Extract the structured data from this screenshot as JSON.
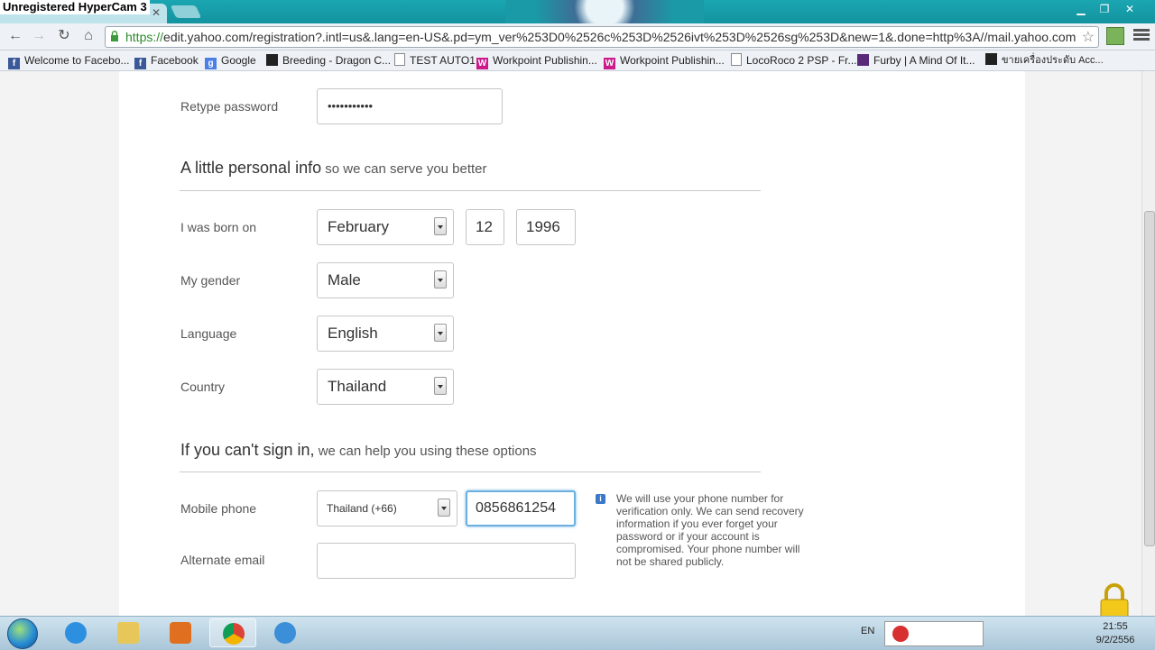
{
  "watermark": "Unregistered HyperCam 3",
  "browser": {
    "tab_close": "✕",
    "window_controls": [
      "▁",
      "❐",
      "✕"
    ],
    "url_scheme": "https://",
    "url_rest": "edit.yahoo.com/registration?.intl=us&.lang=en-US&.pd=ym_ver%253D0%2526c%253D%2526ivt%253D%2526sg%253D&new=1&.done=http%3A//mail.yahoo.com",
    "nav_icons": [
      "back-icon",
      "forward-icon",
      "reload-icon",
      "home-icon"
    ]
  },
  "bookmarks": [
    {
      "label": "Welcome to Facebo...",
      "icon": "facebook-icon"
    },
    {
      "label": "Facebook",
      "icon": "facebook-icon"
    },
    {
      "label": "Google",
      "icon": "google-icon"
    },
    {
      "label": "Breeding - Dragon C...",
      "icon": "dragon-icon"
    },
    {
      "label": "TEST AUTO1",
      "icon": "page-icon"
    },
    {
      "label": "Workpoint Publishin...",
      "icon": "workpoint-icon"
    },
    {
      "label": "Workpoint Publishin...",
      "icon": "workpoint-icon"
    },
    {
      "label": "LocoRoco 2 PSP - Fr...",
      "icon": "page-icon"
    },
    {
      "label": "Furby | A Mind Of It...",
      "icon": "furby-icon"
    },
    {
      "label": "ขายเครื่องประดับ Acc...",
      "icon": "dark-icon"
    }
  ],
  "form": {
    "retype_password": {
      "label": "Retype password",
      "value": "•••••••••••"
    },
    "personal_section": {
      "title": "A little personal info",
      "subtitle": " so we can serve you better"
    },
    "birth": {
      "label": "I was born on",
      "month": "February",
      "day": "12",
      "year": "1996"
    },
    "gender": {
      "label": "My gender",
      "value": "Male"
    },
    "language": {
      "label": "Language",
      "value": "English"
    },
    "country": {
      "label": "Country",
      "value": "Thailand"
    },
    "recovery_section": {
      "title": "If you can't sign in,",
      "subtitle": " we can help you using these options"
    },
    "mobile": {
      "label": "Mobile phone",
      "country_code": "Thailand (+66)",
      "number": "0856861254"
    },
    "alternate_email": {
      "label": "Alternate email",
      "value": ""
    },
    "help_text": "We will use your phone number for verification only. We can send recovery information if you ever forget your password or if your account is compromised. Your phone number will not be shared publicly."
  },
  "taskbar": {
    "language": "EN",
    "clock_time": "21:55",
    "clock_date": "9/2/2556",
    "apps": [
      "internet-explorer-icon",
      "file-explorer-icon",
      "media-player-icon",
      "chrome-icon",
      "itunes-icon"
    ]
  }
}
